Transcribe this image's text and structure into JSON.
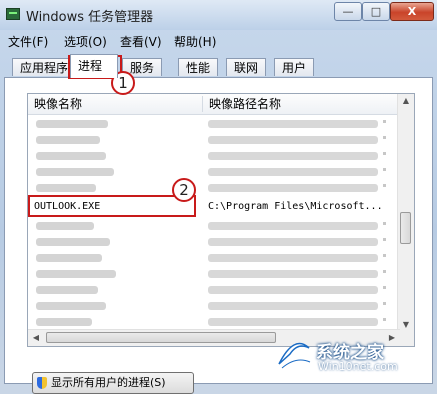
{
  "window": {
    "title": "Windows 任务管理器"
  },
  "title_controls": {
    "minimize": "—",
    "maximize": "□",
    "close": "X"
  },
  "menu": [
    {
      "label": "文件(F)"
    },
    {
      "label": "选项(O)"
    },
    {
      "label": "查看(V)"
    },
    {
      "label": "帮助(H)"
    }
  ],
  "tabs": [
    {
      "label": "应用程序",
      "active": false
    },
    {
      "label": "进程",
      "active": true
    },
    {
      "label": "服务",
      "active": false
    },
    {
      "label": "性能",
      "active": false
    },
    {
      "label": "联网",
      "active": false
    },
    {
      "label": "用户",
      "active": false
    }
  ],
  "process_list": {
    "columns": [
      "映像名称",
      "映像路径名称"
    ],
    "highlighted_row": {
      "image_name": "OUTLOOK.EXE",
      "image_path": "C:\\Program Files\\Microsoft..."
    }
  },
  "callouts": [
    {
      "number": "1",
      "target": "进程 tab"
    },
    {
      "number": "2",
      "target": "OUTLOOK.EXE row"
    }
  ],
  "bottom_button": {
    "label": "显示所有用户的进程(S)"
  },
  "watermark": {
    "title": "系统之家",
    "url": "Win10net.com"
  },
  "colors": {
    "callout": "#c81a1a",
    "titlebar": "#bcd0e8",
    "close_button": "#c9442a"
  }
}
